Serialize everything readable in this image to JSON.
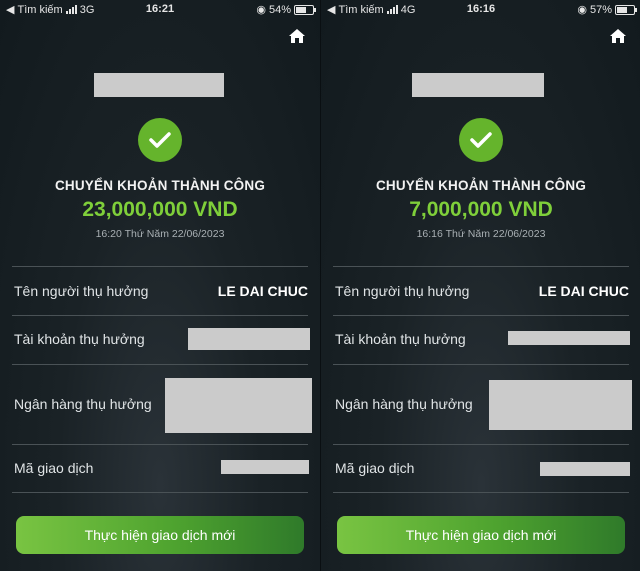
{
  "screens": [
    {
      "status": {
        "carrier": "Tìm kiếm",
        "network": "3G",
        "time": "16:21",
        "battery": "54%",
        "battery_level": 0.54
      },
      "title": "CHUYỂN KHOẢN THÀNH CÔNG",
      "amount": "23,000,000 VND",
      "datetime": "16:20 Thứ Năm 22/06/2023",
      "rows": [
        {
          "label": "Tên người thụ hưởng",
          "value": "LE DAI CHUC"
        },
        {
          "label": "Tài khoản thụ hưởng",
          "value": ""
        },
        {
          "label": "Ngân hàng thụ hưởng",
          "value": ""
        },
        {
          "label": "Mã giao dịch",
          "value": ""
        }
      ],
      "button": "Thực hiện giao dịch mới"
    },
    {
      "status": {
        "carrier": "Tìm kiếm",
        "network": "4G",
        "time": "16:16",
        "battery": "57%",
        "battery_level": 0.57
      },
      "title": "CHUYỂN KHOẢN THÀNH CÔNG",
      "amount": "7,000,000 VND",
      "datetime": "16:16 Thứ Năm 22/06/2023",
      "rows": [
        {
          "label": "Tên người thụ hưởng",
          "value": "LE DAI CHUC"
        },
        {
          "label": "Tài khoản thụ hưởng",
          "value": ""
        },
        {
          "label": "Ngân hàng thụ hưởng",
          "value": ""
        },
        {
          "label": "Mã giao dịch",
          "value": ""
        }
      ],
      "button": "Thực hiện giao dịch mới"
    }
  ],
  "icons": {
    "success": "check-icon",
    "home": "home-icon",
    "rotation_lock": "rotation-lock-icon"
  },
  "colors": {
    "success_green": "#65b42c",
    "amount_green": "#7fcf3a",
    "button_start": "#79c442",
    "button_end": "#2f7a2a",
    "background": "#1a2226"
  }
}
